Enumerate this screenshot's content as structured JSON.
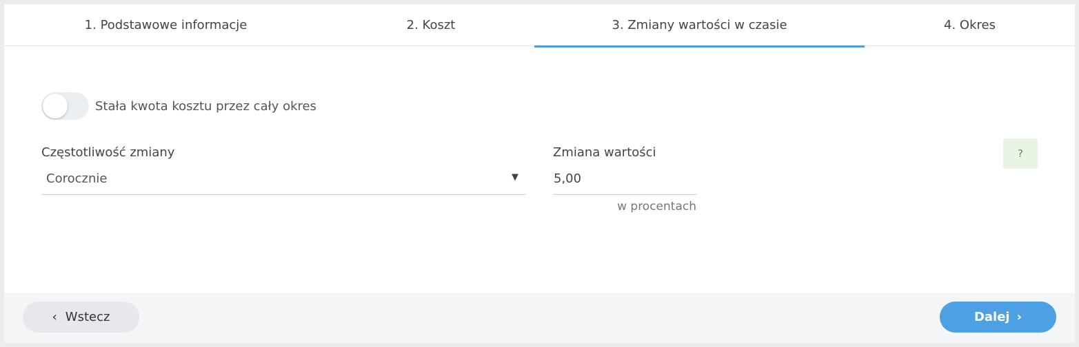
{
  "tabs": [
    {
      "label": "1. Podstawowe informacje"
    },
    {
      "label": "2. Koszt"
    },
    {
      "label": "3. Zmiany wartości w czasie",
      "active": true
    },
    {
      "label": "4. Okres"
    }
  ],
  "toggle": {
    "label": "Stała kwota kosztu przez cały okres",
    "checked": false
  },
  "frequency": {
    "label": "Częstotliwość zmiany",
    "value": "Corocznie",
    "caret": "▼"
  },
  "value_change": {
    "label": "Zmiana wartości",
    "value": "5,00",
    "hint": "w procentach"
  },
  "help": {
    "label": "?"
  },
  "footer": {
    "back_label": "Wstecz",
    "back_icon": "‹",
    "next_label": "Dalej",
    "next_icon": "›"
  },
  "colors": {
    "accent": "#4a9de0",
    "help_bg": "#e9f4e4"
  }
}
